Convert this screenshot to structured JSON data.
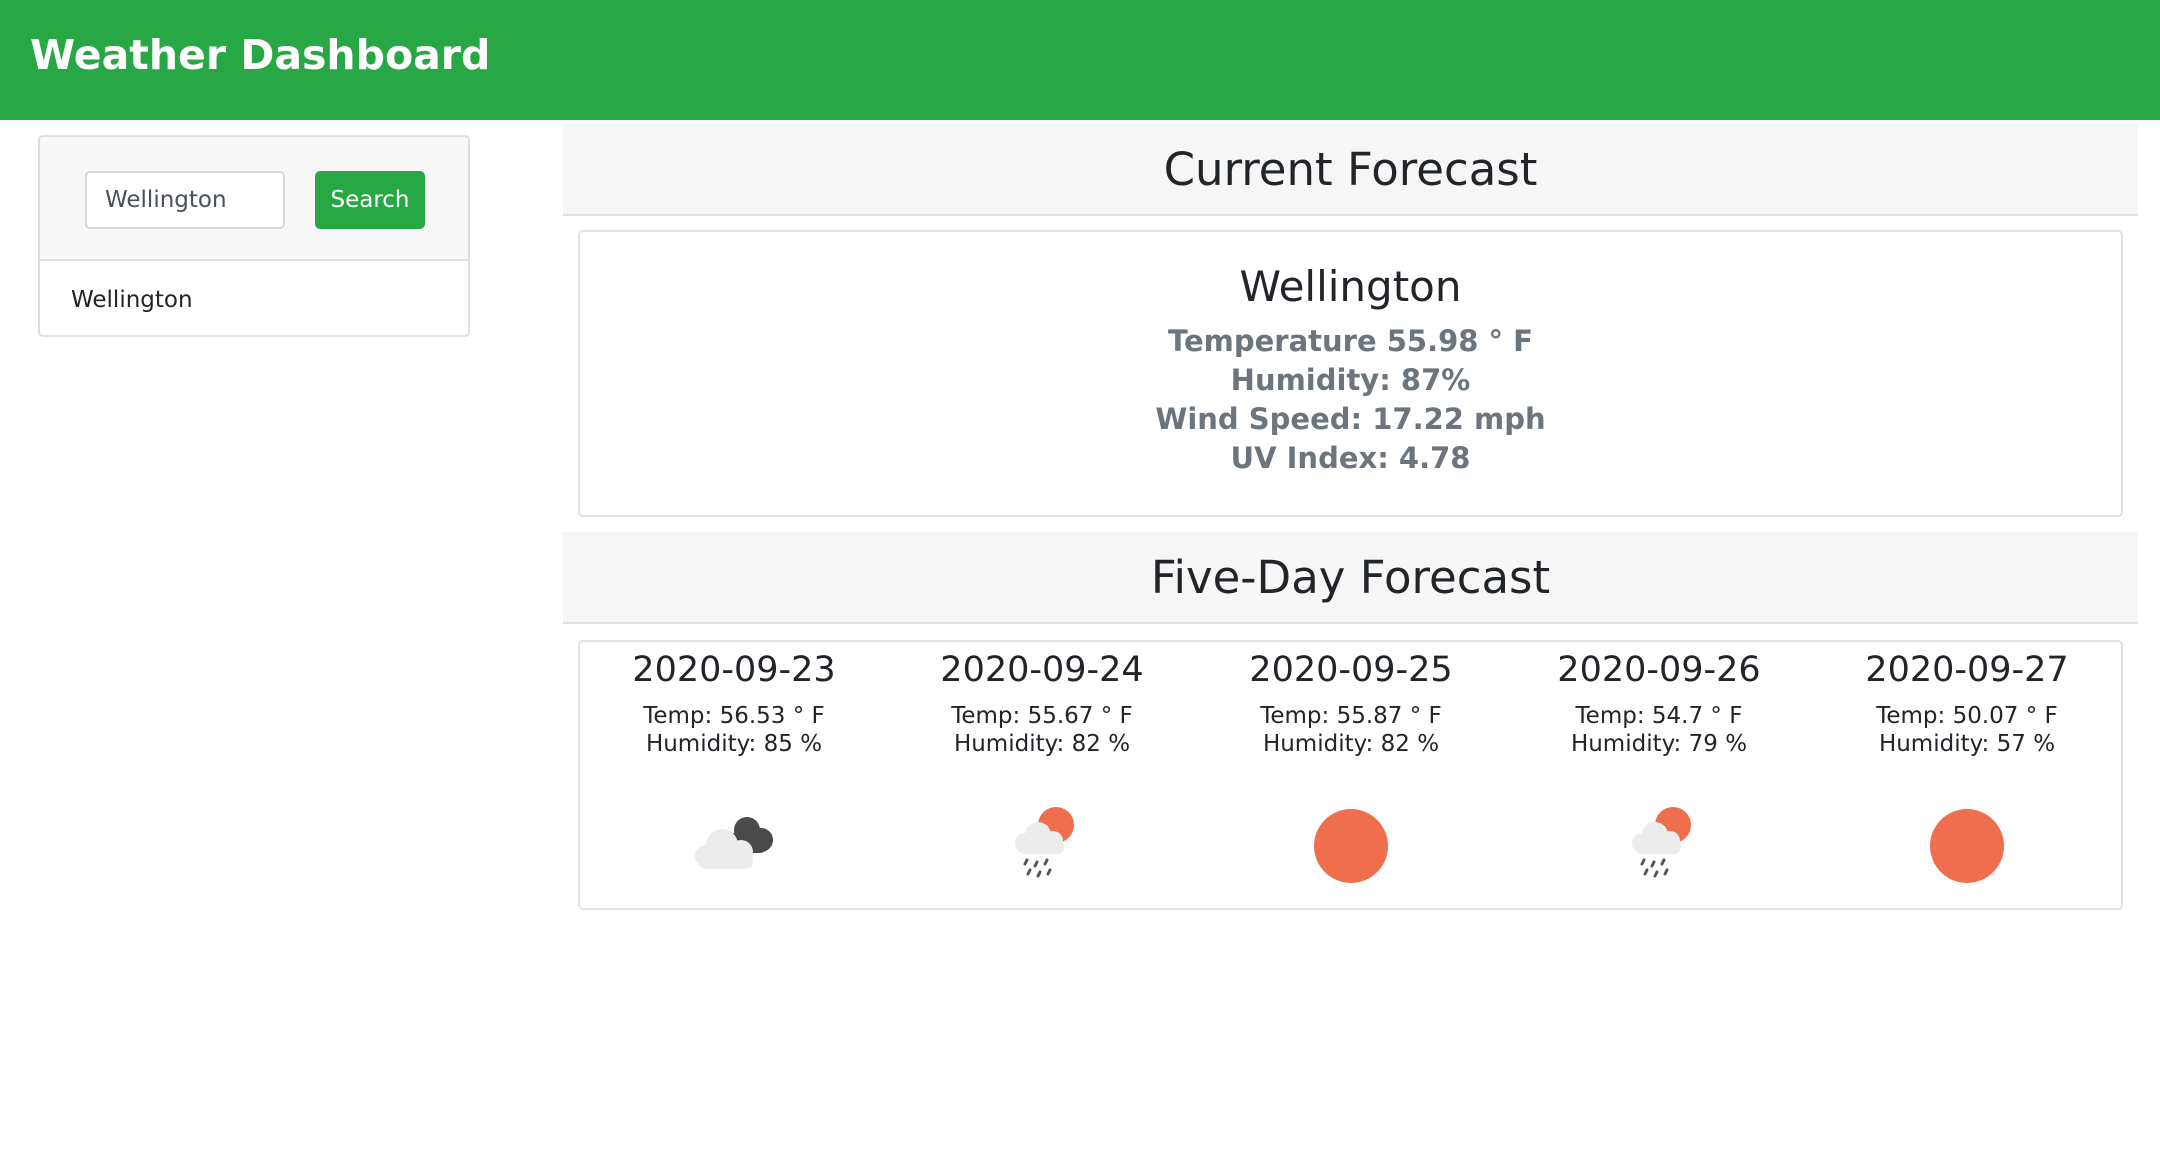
{
  "header": {
    "title": "Weather Dashboard",
    "accent_color": "#28a745"
  },
  "search": {
    "value": "Wellington",
    "placeholder": "",
    "button_label": "Search"
  },
  "history": {
    "items": [
      {
        "label": "Wellington"
      }
    ]
  },
  "current": {
    "heading": "Current Forecast",
    "city": "Wellington",
    "temperature": "Temperature 55.98 ° F",
    "humidity": "Humidity: 87%",
    "wind_speed": "Wind Speed: 17.22 mph",
    "uv_index": "UV Index: 4.78"
  },
  "five_day": {
    "heading": "Five-Day Forecast",
    "days": [
      {
        "date": "2020-09-23",
        "temp": "Temp: 56.53 ° F",
        "humidity": "Humidity: 85 %",
        "icon": "dark-cloud-icon"
      },
      {
        "date": "2020-09-24",
        "temp": "Temp: 55.67 ° F",
        "humidity": "Humidity: 82 %",
        "icon": "rain-sun-icon"
      },
      {
        "date": "2020-09-25",
        "temp": "Temp: 55.87 ° F",
        "humidity": "Humidity: 82 %",
        "icon": "sun-icon"
      },
      {
        "date": "2020-09-26",
        "temp": "Temp: 54.7 ° F",
        "humidity": "Humidity: 79 %",
        "icon": "rain-sun-icon"
      },
      {
        "date": "2020-09-27",
        "temp": "Temp: 50.07 ° F",
        "humidity": "Humidity: 57 %",
        "icon": "sun-icon"
      }
    ]
  }
}
